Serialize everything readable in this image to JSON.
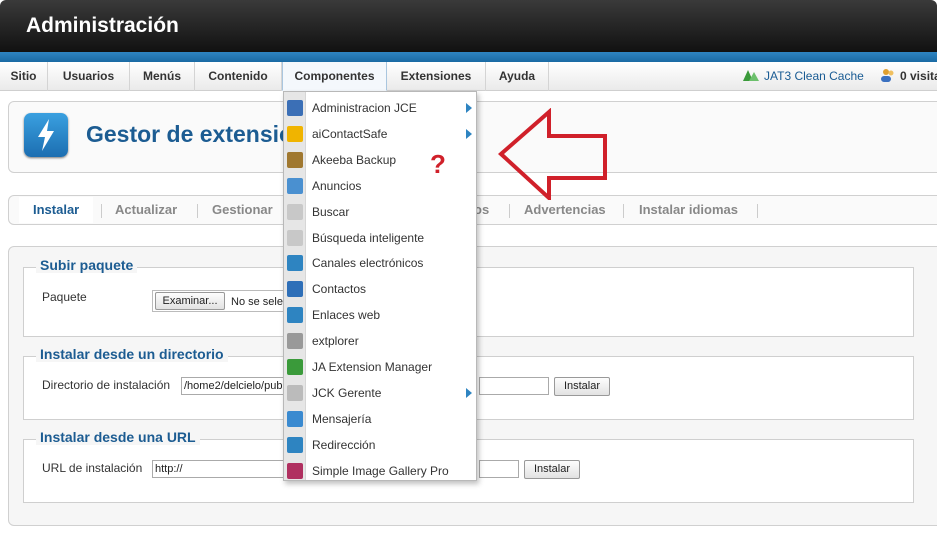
{
  "header": {
    "title": "Administración"
  },
  "menubar": {
    "items": [
      "Sitio",
      "Usuarios",
      "Menús",
      "Contenido",
      "Componentes",
      "Extensiones",
      "Ayuda"
    ],
    "active": "Componentes"
  },
  "status": {
    "cache_label": "JAT3 Clean Cache",
    "visits_label": "0 visita"
  },
  "page": {
    "title": "Gestor de extensiones"
  },
  "tabs": [
    "Instalar",
    "Actualizar",
    "Gestionar",
    "os",
    "Advertencias",
    "Instalar idiomas"
  ],
  "panels": {
    "upload": {
      "legend": "Subir paquete",
      "label": "Paquete",
      "browse_button": "Examinar...",
      "no_file": "No se selec"
    },
    "directory": {
      "legend": "Instalar desde un directorio",
      "label": "Directorio de instalación",
      "value": "/home2/delcielo/pub",
      "button": "Instalar"
    },
    "url": {
      "legend": "Instalar desde una URL",
      "label": "URL de instalación",
      "value": "http://",
      "button": "Instalar"
    }
  },
  "dropdown": {
    "items": [
      {
        "label": "Administracion JCE",
        "icon": "jce-icon",
        "submenu": true,
        "color": "#3b6fb6"
      },
      {
        "label": "aiContactSafe",
        "icon": "envelope-icon",
        "submenu": true,
        "color": "#f0b400"
      },
      {
        "label": "Akeeba Backup",
        "icon": "akeeba-icon",
        "submenu": false,
        "color": "#a07830"
      },
      {
        "label": "Anuncios",
        "icon": "banners-icon",
        "submenu": false,
        "color": "#4a90d0"
      },
      {
        "label": "Buscar",
        "icon": "search-icon",
        "submenu": false,
        "color": "#c8c8c8"
      },
      {
        "label": "Búsqueda inteligente",
        "icon": "search-icon",
        "submenu": false,
        "color": "#c8c8c8"
      },
      {
        "label": "Canales electrónicos",
        "icon": "rss-icon",
        "submenu": false,
        "color": "#2e84c1"
      },
      {
        "label": "Contactos",
        "icon": "contact-icon",
        "submenu": false,
        "color": "#2e6fb8"
      },
      {
        "label": "Enlaces web",
        "icon": "globe-icon",
        "submenu": false,
        "color": "#2e84c1"
      },
      {
        "label": "extplorer",
        "icon": "tools-icon",
        "submenu": false,
        "color": "#999999"
      },
      {
        "label": "JA Extension Manager",
        "icon": "ja-icon",
        "submenu": false,
        "color": "#3a9a3a"
      },
      {
        "label": "JCK Gerente",
        "icon": "jck-icon",
        "submenu": true,
        "color": "#bbbbbb"
      },
      {
        "label": "Mensajería",
        "icon": "message-icon",
        "submenu": false,
        "color": "#3a8ad0"
      },
      {
        "label": "Redirección",
        "icon": "redirect-icon",
        "submenu": false,
        "color": "#2e84c1"
      },
      {
        "label": "Simple Image Gallery Pro",
        "icon": "gallery-icon",
        "submenu": false,
        "color": "#b03060"
      }
    ]
  },
  "annotation": {
    "question_mark": "?"
  }
}
